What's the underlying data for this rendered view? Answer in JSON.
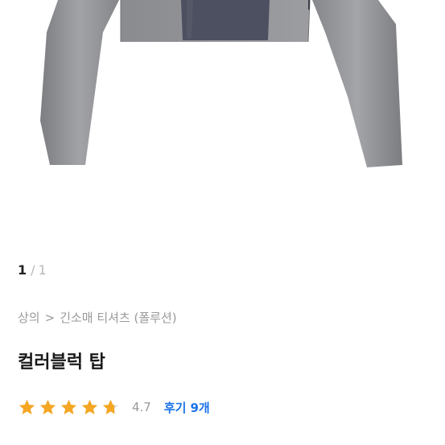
{
  "image_pager": {
    "current": "1",
    "separator": "/",
    "total": "1"
  },
  "breadcrumb": {
    "category": "상의",
    "separator": ">",
    "subcategory": "긴소매 티셔츠 (폴루션)"
  },
  "product": {
    "title": "컬러블럭 탑"
  },
  "rating": {
    "value": "4.7",
    "stars_filled": 4.7,
    "stars_max": 5,
    "star_color": "#f5a623",
    "star_empty_color": "#e0e0e0"
  },
  "reviews": {
    "label": "후기",
    "count": "9개",
    "link_color": "#1a73e8"
  }
}
